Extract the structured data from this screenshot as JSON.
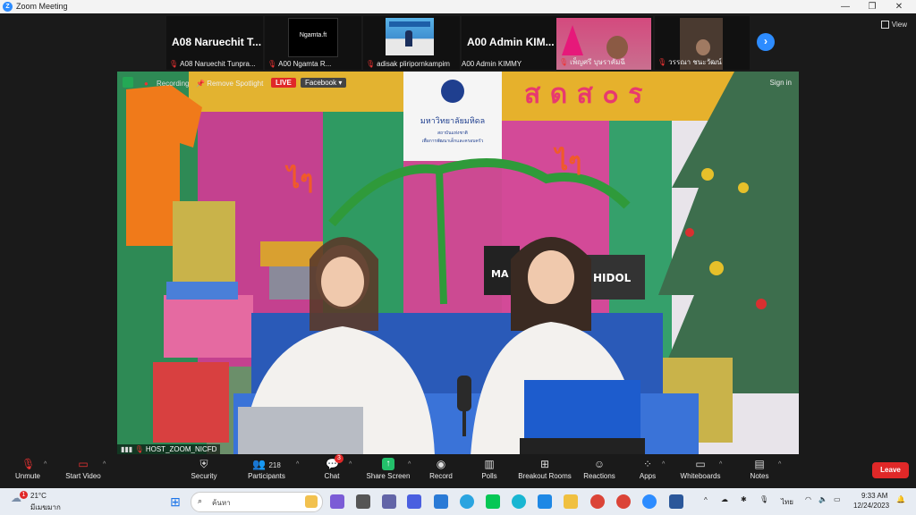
{
  "window": {
    "title": "Zoom Meeting",
    "app_icon": "Z",
    "minimize": "—",
    "maximize": "❐",
    "close": "✕"
  },
  "view_button": {
    "label": "View"
  },
  "thumbnails": [
    {
      "big_name": "A08  Naruechit T...",
      "caption": "A08 Naruechit Tunpra..."
    },
    {
      "inner_text": "Ngamta.ft",
      "caption": "A00 Ngamta R..."
    },
    {
      "caption": "adisak pliripornkampim"
    },
    {
      "big_name": "A00  Admin  KIM...",
      "caption": "A00 Admin KIMMY"
    },
    {
      "caption": "เพ็ญศรี บุษราคัมฉี"
    },
    {
      "caption": "วรรณา ชนะวัฒน์"
    }
  ],
  "video": {
    "recording_label": "Recording",
    "remove_spotlight": "Remove Spotlight",
    "live_badge": "LIVE",
    "facebook_label": "Facebook",
    "sign_in": "Sign in",
    "host_label": "HOST_ZOOM_NICFD",
    "banner_text": "มหาวิทยาลัยมหิดล",
    "banner_sub1": "สถาบันแห่งชาติ",
    "banner_sub2": "เพื่อการพัฒนาเด็กและครอบครัว",
    "bag_text1": "MA",
    "bag_text2": "HIDOL"
  },
  "toolbar": {
    "unmute": "Unmute",
    "start_video": "Start Video",
    "security": "Security",
    "participants": "Participants",
    "participants_count": "218",
    "chat": "Chat",
    "chat_badge": "3",
    "share_screen": "Share Screen",
    "record": "Record",
    "polls": "Polls",
    "breakout_rooms": "Breakout Rooms",
    "reactions": "Reactions",
    "apps": "Apps",
    "whiteboards": "Whiteboards",
    "notes": "Notes",
    "leave": "Leave"
  },
  "taskbar": {
    "weather_temp": "21°C",
    "weather_desc": "มีเมฆมาก",
    "weather_badge": "1",
    "search_placeholder": "ค้นหา",
    "language": "ไทย",
    "time": "9:33 AM",
    "date": "12/24/2023"
  },
  "colors": {
    "zoom_blue": "#2D8CFF",
    "leave_red": "#E02828",
    "share_green": "#23C06A"
  }
}
